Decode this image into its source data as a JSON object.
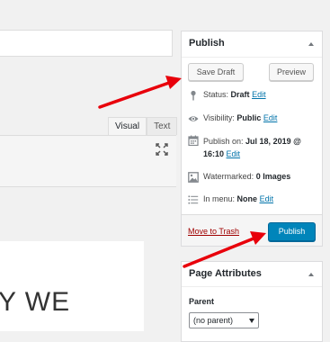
{
  "editor": {
    "tabs": [
      {
        "label": "Visual",
        "active": true
      },
      {
        "label": "Text",
        "active": false
      }
    ],
    "content_text": "Y WE"
  },
  "publish": {
    "title": "Publish",
    "save_draft_label": "Save Draft",
    "preview_label": "Preview",
    "status": {
      "label": "Status:",
      "value": "Draft",
      "edit": "Edit"
    },
    "visibility": {
      "label": "Visibility:",
      "value": "Public",
      "edit": "Edit"
    },
    "publish_on": {
      "label": "Publish on:",
      "date": "Jul 18, 2019 @",
      "time": "16:10",
      "edit": "Edit"
    },
    "watermarked": {
      "label": "Watermarked:",
      "value": "0 Images"
    },
    "in_menu": {
      "label": "In menu:",
      "value": "None",
      "edit": "Edit"
    },
    "trash_label": "Move to Trash",
    "publish_label": "Publish"
  },
  "page_attributes": {
    "title": "Page Attributes",
    "parent_label": "Parent",
    "parent_value": "(no parent)"
  },
  "icons": {
    "status": "pin-icon",
    "visibility": "eye-icon",
    "publish_on": "calendar-icon",
    "watermarked": "image-icon",
    "in_menu": "list-icon",
    "fullscreen": "fullscreen-icon",
    "toggle": "chevron-up-icon"
  },
  "colors": {
    "primary_button": "#0085ba",
    "link": "#0073aa",
    "trash": "#a00000",
    "annotation_arrow": "#e8000b"
  }
}
